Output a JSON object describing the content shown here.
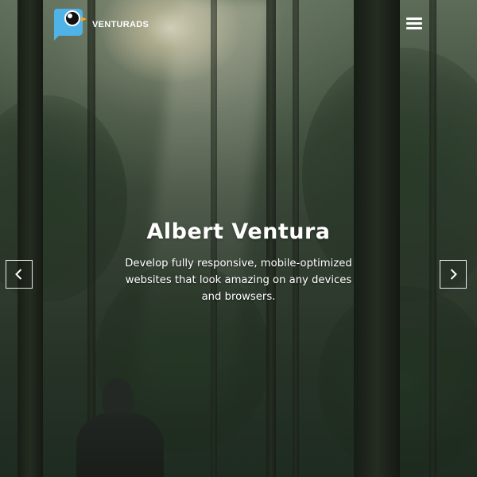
{
  "brand": {
    "name": "VENTURADS",
    "logo_icon": "bird-logo-icon",
    "logo_color": "#4fb3e8",
    "accent_color": "#f5a623"
  },
  "header": {
    "menu_icon": "hamburger-menu-icon"
  },
  "slide": {
    "title": "Albert Ventura",
    "subtitle": "Develop fully responsive, mobile-optimized websites that look amazing on any devices and browsers."
  },
  "carousel": {
    "prev_icon": "chevron-left-icon",
    "next_icon": "chevron-right-icon"
  }
}
